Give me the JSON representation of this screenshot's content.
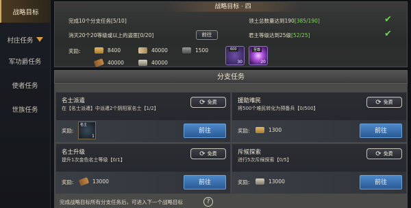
{
  "sidebar": {
    "items": [
      {
        "label": "战略目标",
        "active": true
      },
      {
        "label": "村庄任务",
        "has_dropdown": true
      },
      {
        "label": "军功爵任务"
      },
      {
        "label": "使者任务"
      },
      {
        "label": "世族任务"
      }
    ]
  },
  "strategy": {
    "title": "战略目标 · 四",
    "tasks": [
      {
        "text": "完成10个分支任务",
        "progress": "[5/10]"
      },
      {
        "text": "领土总数量达到190",
        "progress": "[385/190]",
        "completed": true
      },
      {
        "text": "消灭20个20等级或以上的盗匪",
        "progress": "[0/20]",
        "button": "前往"
      },
      {
        "text": "君主等级达到25级",
        "progress": "[52/25]",
        "completed": true
      }
    ],
    "reward_label": "奖励:",
    "rewards": [
      {
        "icon": "grain-icon",
        "value": "8400"
      },
      {
        "icon": "rope-icon",
        "value": "40000"
      },
      {
        "icon": "iron-icon",
        "value": "1500"
      },
      {
        "icon": "wood-icon",
        "value": "40000"
      },
      {
        "icon": "coin-icon",
        "value": "40000"
      }
    ],
    "items": [
      {
        "tag": "600",
        "count": "30"
      },
      {
        "tag": "至尊",
        "count": "20"
      }
    ]
  },
  "branch": {
    "title": "分支任务",
    "free_label": "免费",
    "goto_label": "前往",
    "reward_label": "奖励:",
    "cards": [
      {
        "title": "名士派遣",
        "desc": "在【名士派遣】中派遣2个阴阳家名士【1/2】",
        "reward_type": "item",
        "item_tag": "名士",
        "item_count": "1"
      },
      {
        "title": "援助难民",
        "desc": "将500个难民转化为预备兵【0/500】",
        "reward_type": "resource",
        "icon": "grain-icon",
        "value": "1300"
      },
      {
        "title": "名士升级",
        "desc": "提升1次金色名士等级【0/1】",
        "reward_type": "resource",
        "icon": "wood-icon",
        "value": "13000"
      },
      {
        "title": "斥候探索",
        "desc": "进行5次斥候探索【0/5】",
        "reward_type": "resource",
        "icon": "coin-icon",
        "value": "13000"
      }
    ]
  },
  "footer": {
    "text": "完成战略目标所有分支任务后，可进入下一个战略目标",
    "help": "?"
  }
}
